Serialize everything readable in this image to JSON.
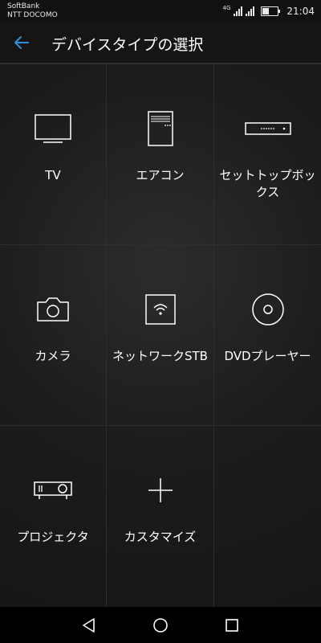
{
  "status_bar": {
    "carrier_1": "SoftBank",
    "carrier_2": "NTT DOCOMO",
    "network_label": "4G",
    "time": "21:04",
    "battery_level": 0.45
  },
  "header": {
    "back_icon": "arrow-left-icon",
    "title": "デバイスタイプの選択",
    "accent_color": "#2f8fd8"
  },
  "devices": [
    {
      "label": "TV",
      "icon": "tv-icon"
    },
    {
      "label": "エアコン",
      "icon": "air-conditioner-icon"
    },
    {
      "label": "セットトップボックス",
      "icon": "set-top-box-icon"
    },
    {
      "label": "カメラ",
      "icon": "camera-icon"
    },
    {
      "label": "ネットワークSTB",
      "icon": "wifi-box-icon"
    },
    {
      "label": "DVDプレーヤー",
      "icon": "disc-icon"
    },
    {
      "label": "プロジェクタ",
      "icon": "projector-icon"
    },
    {
      "label": "カスタマイズ",
      "icon": "plus-icon"
    }
  ],
  "nav_bar": {
    "back_icon": "triangle-back-icon",
    "home_icon": "circle-home-icon",
    "recent_icon": "square-recent-icon"
  }
}
